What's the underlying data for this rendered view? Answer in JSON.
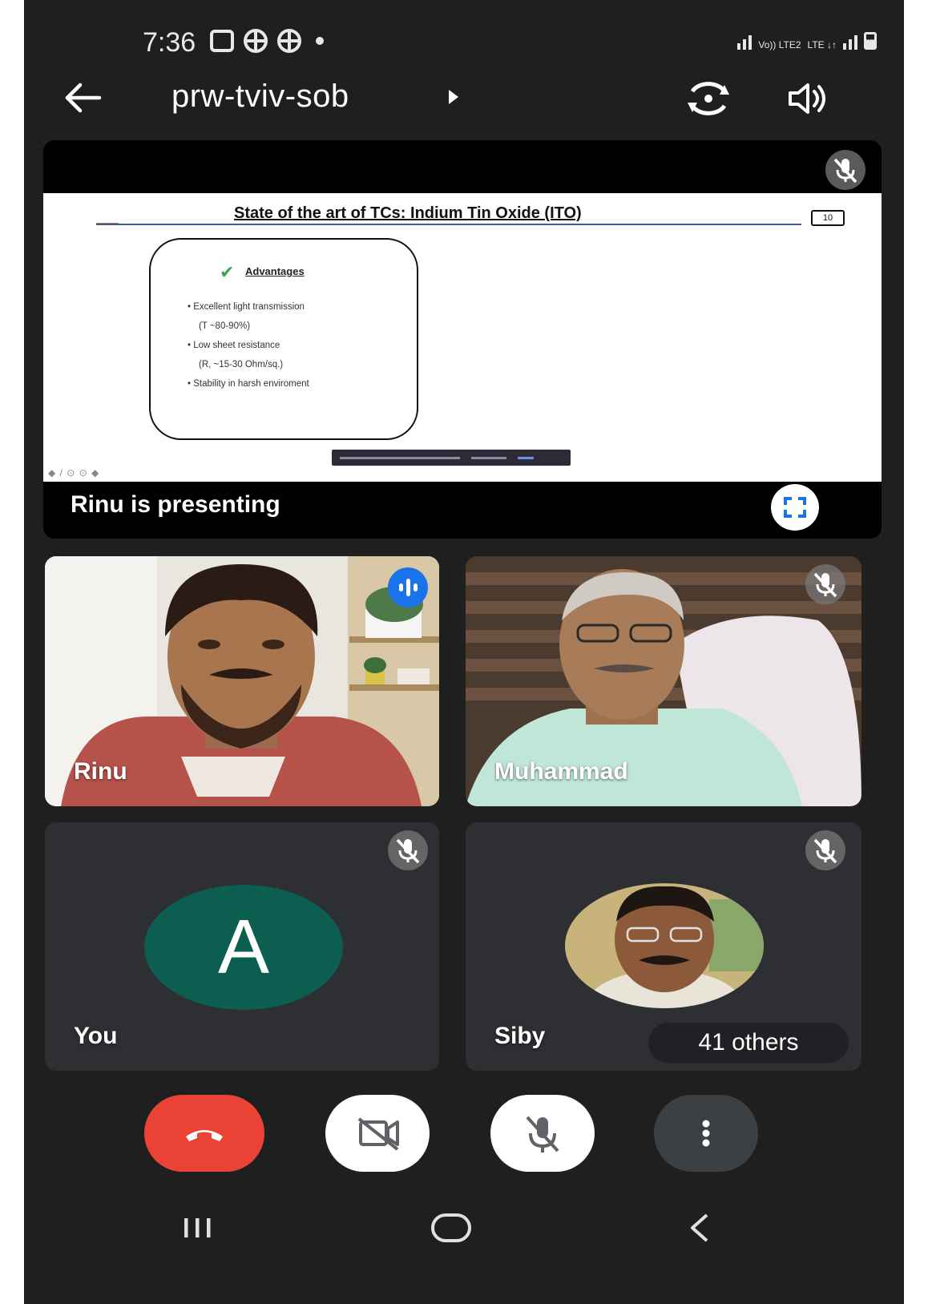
{
  "status_bar": {
    "time": "7:36",
    "network_label_1": "Vo)) LTE2",
    "network_label_2": "LTE ↓↑"
  },
  "header": {
    "back_icon": "arrow-left-icon",
    "meeting_code": "prw-tviv-sob",
    "switch_camera_icon": "switch-camera-icon",
    "audio_output_icon": "speaker-icon"
  },
  "presentation": {
    "slide": {
      "title": "State of the art of TCs: Indium Tin Oxide (ITO)",
      "page_number": "10",
      "heading": "Advantages",
      "items": [
        "Excellent light transmission",
        "(T ~80-90%)",
        "Low sheet resistance",
        "(R, ~15-30 Ohm/sq.)",
        "Stability in harsh enviroment"
      ],
      "nav": "◆ / ⊙ ⊙ ◆"
    },
    "presenting_label": "Rinu is presenting",
    "fullscreen_icon": "fullscreen-icon"
  },
  "participants": {
    "rinu": {
      "name": "Rinu",
      "status_icon": "speaking-icon"
    },
    "muhammad": {
      "name": "Muhammad",
      "status_icon": "mic-off-icon"
    },
    "you": {
      "name": "You",
      "avatar_letter": "A",
      "status_icon": "mic-off-icon"
    },
    "siby": {
      "name": "Siby",
      "status_icon": "mic-off-icon",
      "others_label": "41 others"
    }
  },
  "controls": {
    "end_call_icon": "end-call-icon",
    "camera_icon": "camera-off-icon",
    "mic_icon": "mic-off-icon",
    "more_icon": "more-vert-icon"
  },
  "colors": {
    "background": "#1f1f1f",
    "end_call": "#ea4335",
    "speaking_badge": "#1a73e8",
    "avatar": "#0b5e50",
    "tile": "#2e2f33"
  }
}
